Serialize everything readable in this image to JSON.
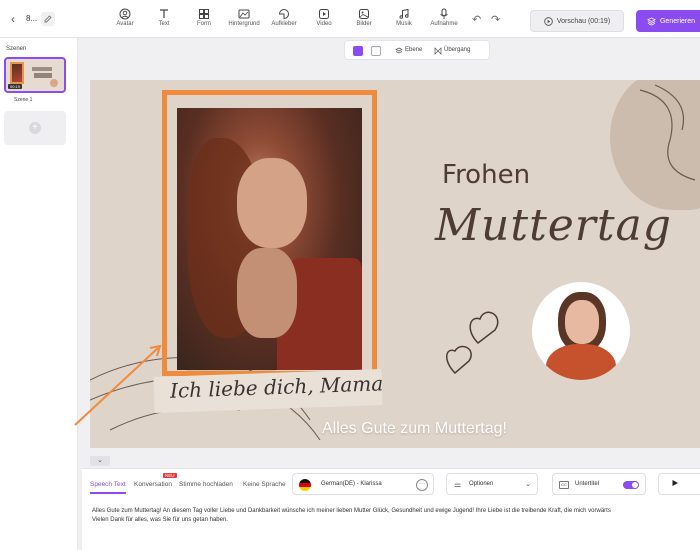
{
  "app": {
    "project_name": "8...",
    "tools": [
      {
        "label": "Avatar",
        "icon": "avatar-icon"
      },
      {
        "label": "Text",
        "icon": "text-icon"
      },
      {
        "label": "Form",
        "icon": "shapes-icon"
      },
      {
        "label": "Hintergrund",
        "icon": "background-icon"
      },
      {
        "label": "Aufkleber",
        "icon": "sticker-icon"
      },
      {
        "label": "Video",
        "icon": "video-icon"
      },
      {
        "label": "Bilder",
        "icon": "image-icon"
      },
      {
        "label": "Musik",
        "icon": "music-icon"
      },
      {
        "label": "Aufnahme",
        "icon": "microphone-icon"
      }
    ],
    "preview_label": "Vorschau (00:19)",
    "generate_label": "Generieren"
  },
  "scenes": {
    "title": "Szenen",
    "items": [
      {
        "label": "Szene 1",
        "duration": "00:19"
      }
    ]
  },
  "canvas_toolbar": {
    "layer_label": "Ebene",
    "transition_label": "Übergang",
    "colors": [
      "#8a4cf0",
      "#ffffff"
    ]
  },
  "canvas": {
    "heading_small": "Frohen",
    "heading_script": "Muttertag",
    "photo_caption": "Ich liebe dich, Mama",
    "subtitle": "Alles Gute zum Muttertag!",
    "background_color": "#dfd4c9",
    "frame_color": "#f08a3c"
  },
  "bottom": {
    "tabs": [
      "Speech Text",
      "Konversation",
      "Stimme hochladen",
      "Keine Sprache"
    ],
    "new_badge": "NEU",
    "voice": "German(DE) - Klarissa",
    "options_label": "Optionen",
    "subtitles_label": "Untertitel",
    "subtitles_icon_text": "CC",
    "script_text": "Alles Gute zum Muttertag! An diesem Tag voller Liebe und Dankbarkeit wünsche ich meiner lieben Mutter Glück, Gesundheit und ewige Jugend! Ihre Liebe ist die treibende Kraft, die mich vorwärts\nVielen Dank für alles, was Sie für uns getan haben."
  }
}
